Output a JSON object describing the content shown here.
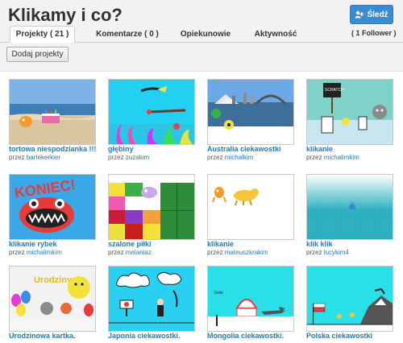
{
  "header": {
    "title": "Klikamy i co?",
    "follow_label": "Śledź",
    "followers": "( 1 Follower )"
  },
  "tabs": [
    {
      "label": "Projekty ( 21 )",
      "active": true
    },
    {
      "label": "Komentarze ( 0 )",
      "active": false
    },
    {
      "label": "Opiekunowie",
      "active": false
    },
    {
      "label": "Aktywność",
      "active": false
    }
  ],
  "toolbar": {
    "add_projects_label": "Dodaj projekty"
  },
  "by_prefix": "przez",
  "projects": [
    {
      "title": "tortowa niespodzianka !!!",
      "author": "bartekerkier"
    },
    {
      "title": "głębiny",
      "author": "zuzakim"
    },
    {
      "title": "Australia ciekawostki",
      "author": "michalkim"
    },
    {
      "title": "klikanie",
      "author": "michalimkim"
    },
    {
      "title": "klikanie rybek",
      "author": "michalimkim"
    },
    {
      "title": "szalone piłki",
      "author": "melaniaz"
    },
    {
      "title": "klikanie",
      "author": "mateuszkrakim"
    },
    {
      "title": "klik klik",
      "author": "lucykim4"
    },
    {
      "title": "Urodzinowa kartka.",
      "author": ""
    },
    {
      "title": "Japonia ciekawostki.",
      "author": ""
    },
    {
      "title": "Mongolia ciekawostki.",
      "author": ""
    },
    {
      "title": "Polska ciekawostki",
      "author": ""
    }
  ],
  "thumb_text": {
    "koniec": "KONIEC!",
    "urodziny": "Urodziny",
    "gobi": "Gobi",
    "scratch_sign": "SCRATCH"
  },
  "colors": {
    "accent": "#3a8cd0",
    "link": "#1f7bbf",
    "header_bg": "#f2f2f2"
  }
}
